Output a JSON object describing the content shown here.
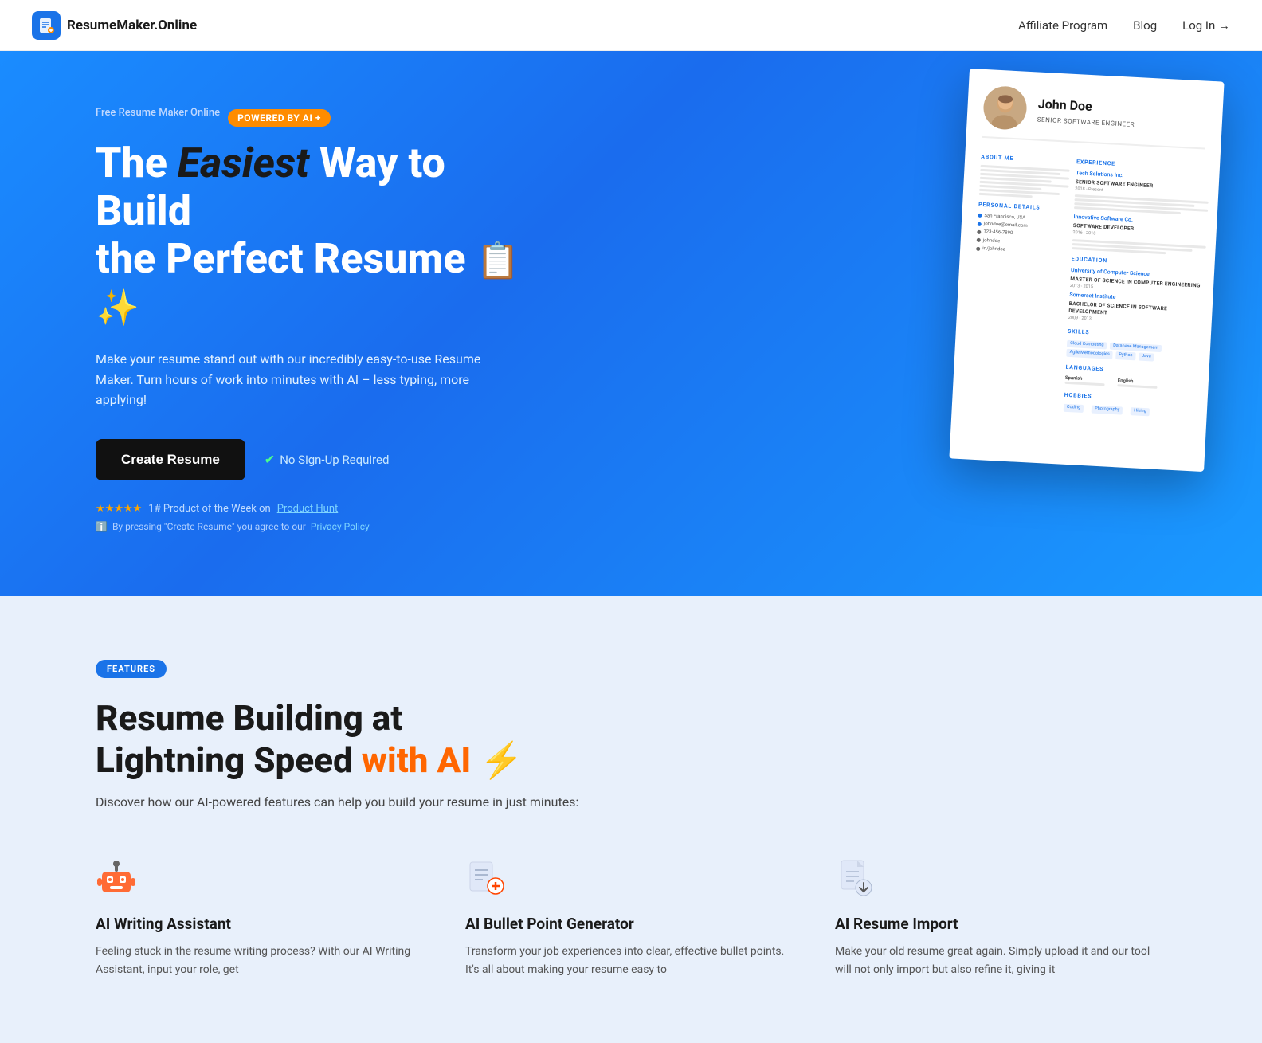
{
  "navbar": {
    "logo_text": "ResumeMaker.Online",
    "affiliate_label": "Affiliate Program",
    "blog_label": "Blog",
    "login_label": "Log In →"
  },
  "hero": {
    "label": "Free Resume Maker Online",
    "ai_badge": "POWERED BY AI +",
    "title_line1": "The ",
    "title_highlight": "Easiest",
    "title_line1_rest": " Way to Build",
    "title_line2": "the Perfect Resume",
    "description": "Make your resume stand out with our incredibly easy-to-use Resume Maker. Turn hours of work into minutes with AI – less typing, more applying!",
    "cta_button": "Create Resume",
    "no_signup": "No Sign-Up Required",
    "rating_text": "1# Product of the Week on",
    "product_hunt": "Product Hunt",
    "privacy_text": "By pressing \"Create Resume\" you agree to our",
    "privacy_link": "Privacy Policy"
  },
  "resume_card": {
    "name": "John Doe",
    "title": "SENIOR SOFTWARE ENGINEER",
    "about_label": "ABOUT ME",
    "experience_label": "EXPERIENCE",
    "company1": "Tech Solutions Inc.",
    "role1": "SENIOR SOFTWARE ENGINEER",
    "date1": "2018 - Present",
    "company2": "Innovative Software Co.",
    "role2": "SOFTWARE DEVELOPER",
    "date2": "2016 - 2018",
    "education_label": "EDUCATION",
    "university1": "University of Computer Science",
    "degree1": "MASTER OF SCIENCE IN COMPUTER ENGINEERING",
    "edu_date1": "2013 - 2015",
    "university2": "Somerset Institute",
    "degree2": "BACHELOR OF SCIENCE IN SOFTWARE DEVELOPMENT",
    "edu_date2": "2009 - 2013",
    "skills_label": "SKILLS",
    "skill1": "Cloud Computing",
    "skill2": "Database Management",
    "skill3": "Agile Methodologies",
    "skill4": "Python",
    "skill5": "Java",
    "languages_label": "LANGUAGES",
    "lang1": "Spanish",
    "lang2": "English",
    "hobbies_label": "HOBBIES",
    "hobby1": "Coding",
    "hobby2": "Photography",
    "hobby3": "Hiking",
    "personal_label": "PERSONAL DETAILS",
    "location": "San Francisco, USA",
    "email": "johndoe@email.com",
    "phone": "123-456-7890",
    "linkedin": "johndoe",
    "instagram": "in/johndoe"
  },
  "features": {
    "badge": "FEATURES",
    "title_line1": "Resume Building at",
    "title_line2_start": "Lightning Speed ",
    "title_line2_orange": "with AI",
    "lightning_symbol": "⚡",
    "description": "Discover how our AI-powered features can help you build your resume in just minutes:",
    "items": [
      {
        "icon": "robot",
        "name": "AI Writing Assistant",
        "desc": "Feeling stuck in the resume writing process? With our AI Writing Assistant, input your role, get"
      },
      {
        "icon": "pen",
        "name": "AI Bullet Point Generator",
        "desc": "Transform your job experiences into clear, effective bullet points. It's all about making your resume easy to"
      },
      {
        "icon": "doc",
        "name": "AI Resume Import",
        "desc": "Make your old resume great again. Simply upload it and our tool will not only import but also refine it, giving it"
      }
    ]
  }
}
